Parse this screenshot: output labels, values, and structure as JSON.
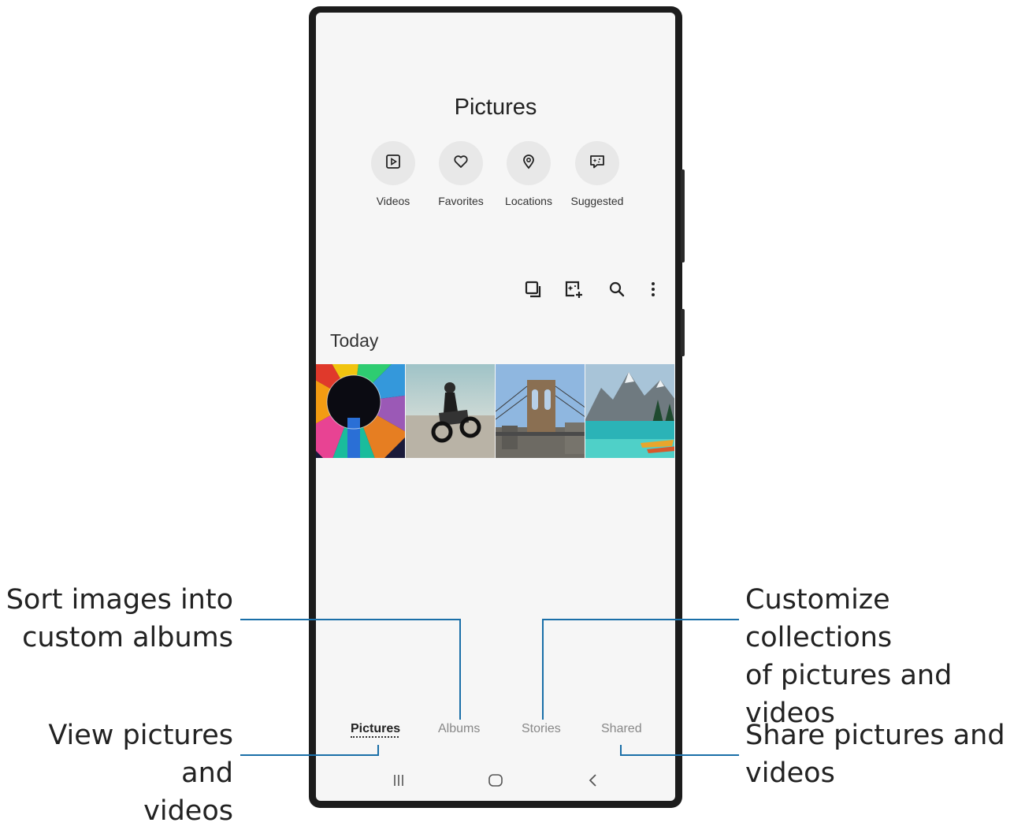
{
  "screen": {
    "title": "Pictures",
    "categories": [
      {
        "label": "Videos",
        "icon": "play-icon"
      },
      {
        "label": "Favorites",
        "icon": "heart-icon"
      },
      {
        "label": "Locations",
        "icon": "location-pin-icon"
      },
      {
        "label": "Suggested",
        "icon": "sparkle-chat-icon"
      }
    ],
    "toolbar_icons": [
      "select-icon",
      "create-icon",
      "search-icon",
      "more-options-icon"
    ],
    "section": "Today",
    "photos": [
      "colorful-ceiling-photo",
      "motorcycle-rider-photo",
      "bridge-photo",
      "mountain-lake-photo"
    ],
    "tabs": [
      {
        "label": "Pictures",
        "active": true
      },
      {
        "label": "Albums",
        "active": false
      },
      {
        "label": "Stories",
        "active": false
      },
      {
        "label": "Shared",
        "active": false
      }
    ],
    "nav_icons": [
      "recent-apps-icon",
      "home-icon",
      "back-icon"
    ]
  },
  "callouts": {
    "albums": [
      "Sort images into",
      "custom albums"
    ],
    "pictures": [
      "View pictures and",
      "videos"
    ],
    "stories": [
      "Customize collections",
      "of pictures and videos"
    ],
    "shared": [
      "Share pictures and",
      "videos"
    ]
  },
  "colors": {
    "callout_line": "#1a6fa8",
    "screen_bg": "#f6f6f6",
    "frame": "#1c1c1c"
  }
}
